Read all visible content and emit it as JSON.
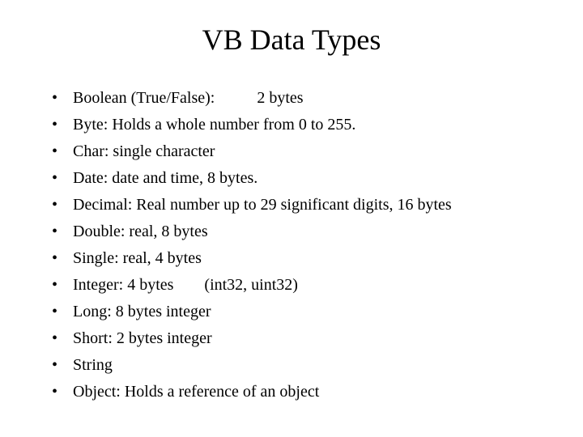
{
  "title": "VB Data Types",
  "items": [
    {
      "pre": "Boolean (True/False):",
      "gap": "gap1",
      "post": "2 bytes"
    },
    {
      "pre": "Byte: Holds a whole number from 0 to 255."
    },
    {
      "pre": "Char: single character"
    },
    {
      "pre": "Date: date and time, 8 bytes."
    },
    {
      "pre": "Decimal: Real number up to 29 significant digits, 16 bytes"
    },
    {
      "pre": "Double: real, 8 bytes"
    },
    {
      "pre": "Single: real, 4 bytes"
    },
    {
      "pre": "Integer: 4 bytes",
      "gap": "gap2",
      "post": "(int32, uint32)"
    },
    {
      "pre": "Long: 8 bytes integer"
    },
    {
      "pre": "Short: 2 bytes integer"
    },
    {
      "pre": "String"
    },
    {
      "pre": "Object: Holds a reference of an object"
    }
  ]
}
